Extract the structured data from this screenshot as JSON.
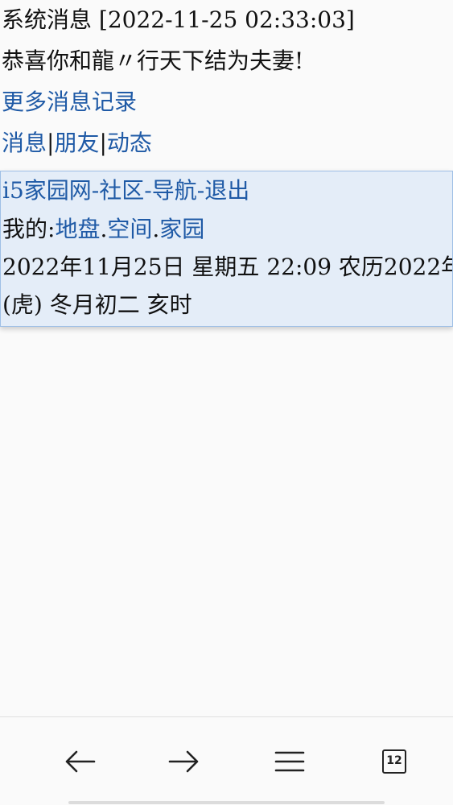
{
  "system_message": {
    "header": "系统消息 [2022-11-25 02:33:03]",
    "body": "恭喜你和龍〃行天下结为夫妻!"
  },
  "more_messages_link": "更多消息记录",
  "quick_nav": {
    "messages": "消息",
    "friends": "朋友",
    "activity": "动态",
    "separator": "|"
  },
  "site_nav": {
    "home": "i5家园网",
    "community": "社区",
    "navigation": "导航",
    "logout": "退出",
    "separator": "-"
  },
  "my_links": {
    "prefix": "我的:",
    "territory": "地盘",
    "space": "空间",
    "home": "家园",
    "separator": "."
  },
  "date_info": {
    "line1": "2022年11月25日  星期五  22:09  农历2022年",
    "line2": "(虎)  冬月初二  亥时"
  },
  "bottom_bar": {
    "back_icon": "arrow-left-icon",
    "forward_icon": "arrow-right-icon",
    "menu_icon": "hamburger-menu-icon",
    "tabs_icon": "tabs-icon",
    "tab_count": "12"
  }
}
